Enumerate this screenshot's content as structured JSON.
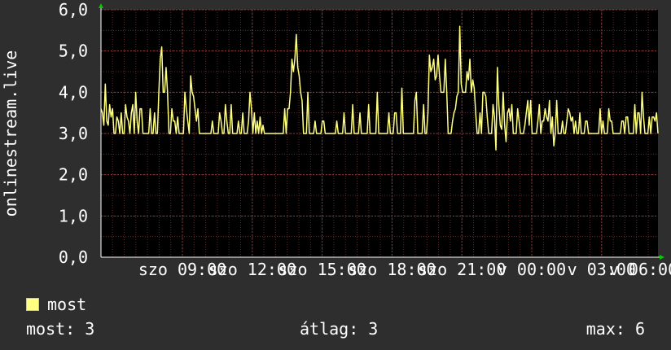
{
  "chart_data": {
    "type": "line",
    "ylabel": "onlinestream.live",
    "ylim": [
      0,
      6
    ],
    "y_ticks": [
      "0,0",
      "1,0",
      "2,0",
      "3,0",
      "4,0",
      "5,0",
      "6,0"
    ],
    "x_ticks": [
      "szo 09:00",
      "szo 12:00",
      "szo 15:00",
      "szo 18:00",
      "szo 21:00",
      "v 00:00",
      "v 03:00",
      "v 06:00"
    ],
    "grid": true,
    "colors": {
      "line": "#ffff80",
      "plot_bg": "#000000",
      "grid": "#5a2a2a",
      "page_bg": "#2e2e2e"
    },
    "series": [
      {
        "name": "most",
        "values": [
          3.6,
          3.5,
          3.2,
          4.2,
          3.3,
          3.2,
          3.7,
          3.4,
          3.6,
          3.0,
          3.0,
          3.4,
          3.3,
          3.0,
          3.5,
          3.0,
          3.0,
          3.7,
          3.4,
          3.3,
          3.0,
          3.5,
          3.7,
          3.0,
          4.0,
          3.3,
          3.0,
          3.6,
          3.6,
          3.0,
          3.0,
          3.0,
          3.0,
          3.0,
          3.6,
          3.0,
          3.0,
          3.5,
          3.0,
          3.0,
          4.0,
          4.8,
          5.1,
          4.0,
          4.0,
          4.6,
          4.0,
          3.0,
          3.0,
          3.6,
          3.3,
          3.3,
          3.0,
          3.4,
          3.0,
          3.0,
          3.0,
          3.0,
          4.0,
          3.6,
          3.3,
          3.0,
          4.4,
          4.0,
          3.9,
          3.6,
          3.3,
          3.6,
          3.0,
          3.0,
          3.0,
          3.0,
          3.0,
          3.0,
          3.0,
          3.0,
          3.0,
          3.3,
          3.0,
          3.0,
          3.0,
          3.0,
          3.5,
          3.3,
          3.0,
          3.0,
          3.7,
          3.3,
          3.0,
          3.0,
          3.7,
          3.0,
          3.0,
          3.0,
          3.0,
          3.3,
          3.0,
          3.0,
          3.5,
          3.0,
          3.0,
          3.0,
          3.3,
          4.0,
          3.6,
          3.0,
          3.5,
          3.0,
          3.3,
          3.0,
          3.4,
          3.0,
          3.2,
          3.0,
          3.0,
          3.0,
          3.0,
          3.0,
          3.0,
          3.0,
          3.0,
          3.0,
          3.0,
          3.0,
          3.0,
          3.0,
          3.0,
          3.6,
          3.0,
          3.6,
          3.6,
          4.0,
          4.8,
          4.5,
          4.8,
          5.4,
          4.6,
          4.4,
          4.0,
          3.8,
          3.0,
          3.0,
          3.0,
          4.0,
          3.0,
          3.0,
          3.0,
          3.0,
          3.3,
          3.0,
          3.0,
          3.0,
          3.0,
          3.3,
          3.3,
          3.0,
          3.0,
          3.0,
          3.0,
          3.0,
          3.0,
          3.0,
          3.0,
          3.3,
          3.0,
          3.0,
          3.0,
          3.0,
          3.5,
          3.0,
          3.0,
          3.0,
          3.0,
          3.0,
          3.7,
          3.0,
          3.0,
          3.0,
          3.0,
          3.5,
          3.0,
          3.0,
          3.0,
          3.0,
          3.0,
          3.7,
          3.0,
          3.0,
          3.0,
          3.0,
          3.0,
          4.0,
          3.0,
          3.0,
          3.0,
          3.0,
          3.0,
          3.0,
          3.0,
          3.5,
          3.0,
          3.0,
          3.0,
          3.5,
          3.5,
          3.0,
          3.0,
          3.0,
          4.1,
          3.0,
          3.0,
          3.0,
          3.0,
          3.0,
          3.0,
          3.0,
          3.0,
          3.8,
          4.0,
          3.0,
          3.0,
          3.0,
          3.0,
          3.7,
          3.0,
          3.0,
          3.5,
          4.9,
          4.5,
          4.6,
          4.8,
          4.3,
          4.4,
          4.9,
          4.4,
          4.0,
          4.0,
          4.0,
          4.8,
          4.0,
          3.0,
          3.0,
          3.0,
          3.3,
          3.5,
          3.6,
          3.9,
          4.0,
          5.6,
          4.2,
          4.0,
          4.0,
          4.0,
          4.5,
          4.3,
          4.8,
          4.0,
          4.3,
          4.1,
          3.5,
          3.0,
          3.0,
          3.5,
          3.0,
          4.0,
          4.0,
          3.9,
          3.4,
          3.0,
          3.0,
          3.0,
          3.7,
          3.4,
          2.6,
          4.6,
          3.7,
          3.2,
          3.1,
          4.0,
          3.2,
          2.8,
          3.5,
          3.6,
          3.3,
          3.7,
          3.0,
          3.0,
          3.0,
          3.6,
          3.3,
          3.0,
          3.0,
          3.0,
          3.2,
          3.5,
          3.8,
          3.2,
          3.8,
          3.0,
          3.0,
          3.0,
          3.0,
          3.3,
          3.7,
          3.0,
          3.3,
          3.3,
          3.6,
          3.4,
          3.3,
          3.8,
          3.0,
          3.4,
          2.7,
          3.0,
          3.8,
          3.0,
          3.0,
          3.0,
          3.3,
          3.0,
          3.0,
          3.3,
          3.6,
          3.5,
          3.3,
          3.4,
          3.0,
          3.3,
          3.0,
          3.0,
          3.5,
          3.0,
          3.0,
          3.0,
          3.3,
          3.3,
          3.0,
          3.0,
          3.0,
          3.0,
          3.0,
          3.0,
          3.0,
          3.0,
          3.6,
          3.0,
          3.3,
          3.0,
          3.0,
          3.0,
          3.6,
          3.3,
          3.3,
          3.0,
          3.0,
          3.0,
          3.0,
          3.0,
          3.0,
          3.3,
          3.3,
          3.0,
          3.4,
          3.4,
          3.0,
          3.0,
          3.0,
          3.0,
          3.7,
          3.0,
          3.5,
          3.5,
          3.0,
          4.0,
          3.4,
          3.0,
          3.0,
          3.0,
          3.4,
          3.0,
          3.4,
          3.4,
          3.3,
          3.5,
          3.0
        ]
      }
    ]
  },
  "legend": {
    "label": "most"
  },
  "stats": {
    "current": "most: 3",
    "average": "átlag: 3",
    "maximum": "max: 6"
  }
}
